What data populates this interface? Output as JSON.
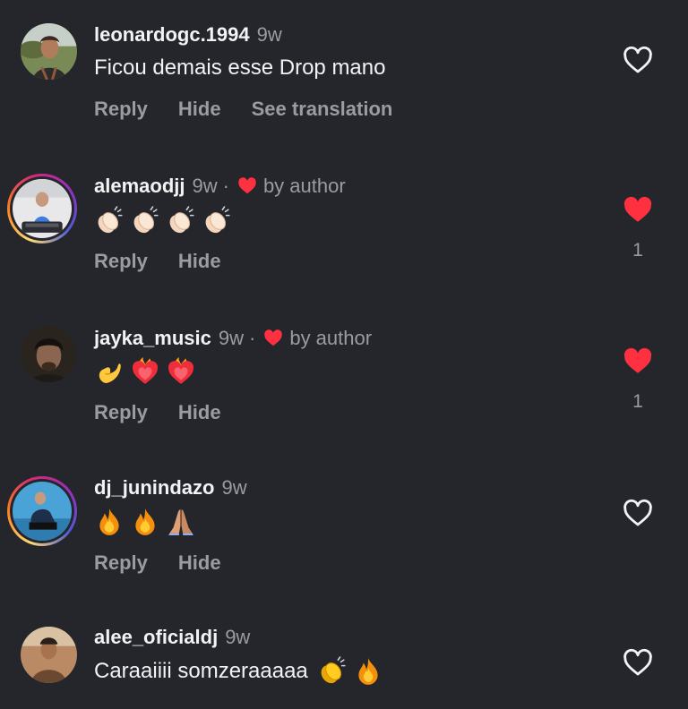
{
  "comments": [
    {
      "username": "leonardogc.1994",
      "time": "9w",
      "text": "Ficou demais esse Drop mano",
      "actions": [
        "Reply",
        "Hide",
        "See translation"
      ],
      "liked": false,
      "like_count": ""
    },
    {
      "username": "alemaodjj",
      "time": "9w",
      "separator": "·",
      "by_author": "by author",
      "emojis": [
        "clapping-hands-emoji",
        "clapping-hands-emoji",
        "clapping-hands-emoji",
        "clapping-hands-emoji"
      ],
      "actions": [
        "Reply",
        "Hide"
      ],
      "liked": true,
      "like_count": "1"
    },
    {
      "username": "jayka_music",
      "time": "9w",
      "separator": "·",
      "by_author": "by author",
      "emojis": [
        "pinching-hand-emoji",
        "heart-on-fire-emoji",
        "heart-on-fire-emoji"
      ],
      "actions": [
        "Reply",
        "Hide"
      ],
      "liked": true,
      "like_count": "1"
    },
    {
      "username": "dj_junindazo",
      "time": "9w",
      "emojis": [
        "fire-emoji",
        "fire-emoji",
        "folded-hands-emoji"
      ],
      "actions": [
        "Reply",
        "Hide"
      ],
      "liked": false,
      "like_count": ""
    },
    {
      "username": "alee_oficialdj",
      "time": "9w",
      "text": "Caraaiiii somzeraaaaa",
      "emojis": [
        "clapping-hands-emoji",
        "fire-emoji"
      ],
      "actions": [],
      "liked": false,
      "like_count": ""
    }
  ],
  "colors": {
    "background": "#24262b",
    "primary_text": "#f2f3f5",
    "secondary_text": "#9a9ca2",
    "like_red": "#ff3040"
  }
}
